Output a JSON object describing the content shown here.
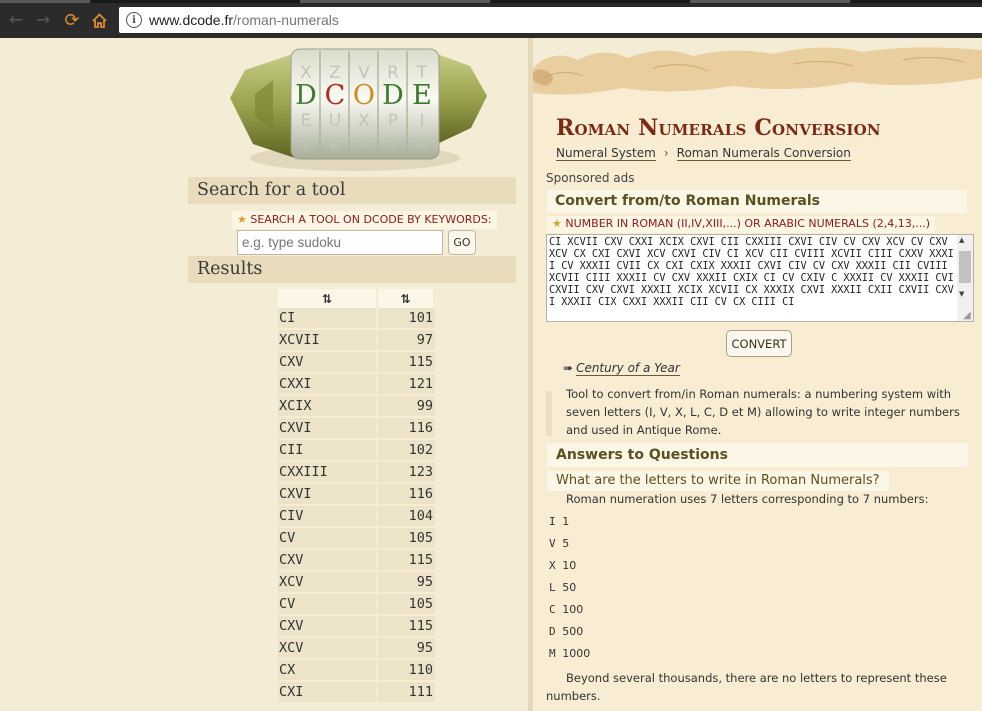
{
  "browser": {
    "url_domain": "www.dcode.fr",
    "url_path": "/roman-numerals",
    "icons": [
      "back-arrow-icon",
      "forward-arrow-icon",
      "reload-icon",
      "home-icon",
      "info-icon"
    ]
  },
  "logo": {
    "letters": [
      "D",
      "C",
      "O",
      "D",
      "E"
    ],
    "colors": {
      "d": "#3a7a2a",
      "c": "#b52a1a",
      "o": "#d08a20",
      "e": "#3a7a2a"
    }
  },
  "search": {
    "heading": "Search for a tool",
    "keywords_label": "SEARCH A TOOL ON DCODE BY KEYWORDS:",
    "placeholder": "e.g. type sudoku",
    "go_label": "GO"
  },
  "results": {
    "heading": "Results",
    "sort_label_1": "⇅",
    "sort_label_2": "⇅",
    "rows": [
      {
        "roman": "CI",
        "value": "101"
      },
      {
        "roman": "XCVII",
        "value": "97"
      },
      {
        "roman": "CXV",
        "value": "115"
      },
      {
        "roman": "CXXI",
        "value": "121"
      },
      {
        "roman": "XCIX",
        "value": "99"
      },
      {
        "roman": "CXVI",
        "value": "116"
      },
      {
        "roman": "CII",
        "value": "102"
      },
      {
        "roman": "CXXIII",
        "value": "123"
      },
      {
        "roman": "CXVI",
        "value": "116"
      },
      {
        "roman": "CIV",
        "value": "104"
      },
      {
        "roman": "CV",
        "value": "105"
      },
      {
        "roman": "CXV",
        "value": "115"
      },
      {
        "roman": "XCV",
        "value": "95"
      },
      {
        "roman": "CV",
        "value": "105"
      },
      {
        "roman": "CXV",
        "value": "115"
      },
      {
        "roman": "XCV",
        "value": "95"
      },
      {
        "roman": "CX",
        "value": "110"
      },
      {
        "roman": "CXI",
        "value": "111"
      }
    ]
  },
  "page": {
    "title": "Roman Numerals Conversion",
    "breadcrumb": [
      "Numeral System",
      "Roman Numerals Conversion"
    ],
    "breadcrumb_sep": "›",
    "sponsored": "Sponsored ads"
  },
  "tool": {
    "heading": "Convert from/to Roman Numerals",
    "input_label": "NUMBER IN ROMAN (II,IV,XIII,...) OR ARABIC NUMERALS (2,4,13,...)",
    "input_value": "CI XCVII CXV CXXI XCIX CXVI CII CXXIII CXVI CIV CV CXV XCV CV CXV XCV CX CXI CXVI XCV CXVI CIV CI XCV CII CVIII XCVII CIII CXXV XXXII CV XXXII CVII CX CXI CXIX XXXII CXVI CIV CV CXV XXXII CII CVIII XCVII CIII XXXII CV CXV XXXII CXIX CI CV CXIV C XXXII CV XXXII CVI CXVII CXV CXVI XXXII XCIX XCVII CX XXXIX CXVI XXXII CXII CXVII CXVI XXXII CIX CXXI XXXII CII CV CX CIII CI",
    "convert_label": "CONVERT",
    "related_arrow": "➠",
    "related_link": "Century of a Year",
    "description": "Tool to convert from/in Roman numerals: a numbering system with seven letters (I, V, X, L, C, D et M) allowing to write integer numbers and used in Antique Rome."
  },
  "faq": {
    "heading": "Answers to Questions",
    "question": "What are the letters to write in Roman Numerals?",
    "answer_intro": "Roman numeration uses 7 letters corresponding to 7 numbers:",
    "letters": [
      {
        "letter": "I",
        "value": "1"
      },
      {
        "letter": "V",
        "value": "5"
      },
      {
        "letter": "X",
        "value": "10"
      },
      {
        "letter": "L",
        "value": "50"
      },
      {
        "letter": "C",
        "value": "100"
      },
      {
        "letter": "D",
        "value": "500"
      },
      {
        "letter": "M",
        "value": "1000"
      }
    ],
    "beyond": "Beyond several thousands, there are no letters to represent these numbers."
  }
}
